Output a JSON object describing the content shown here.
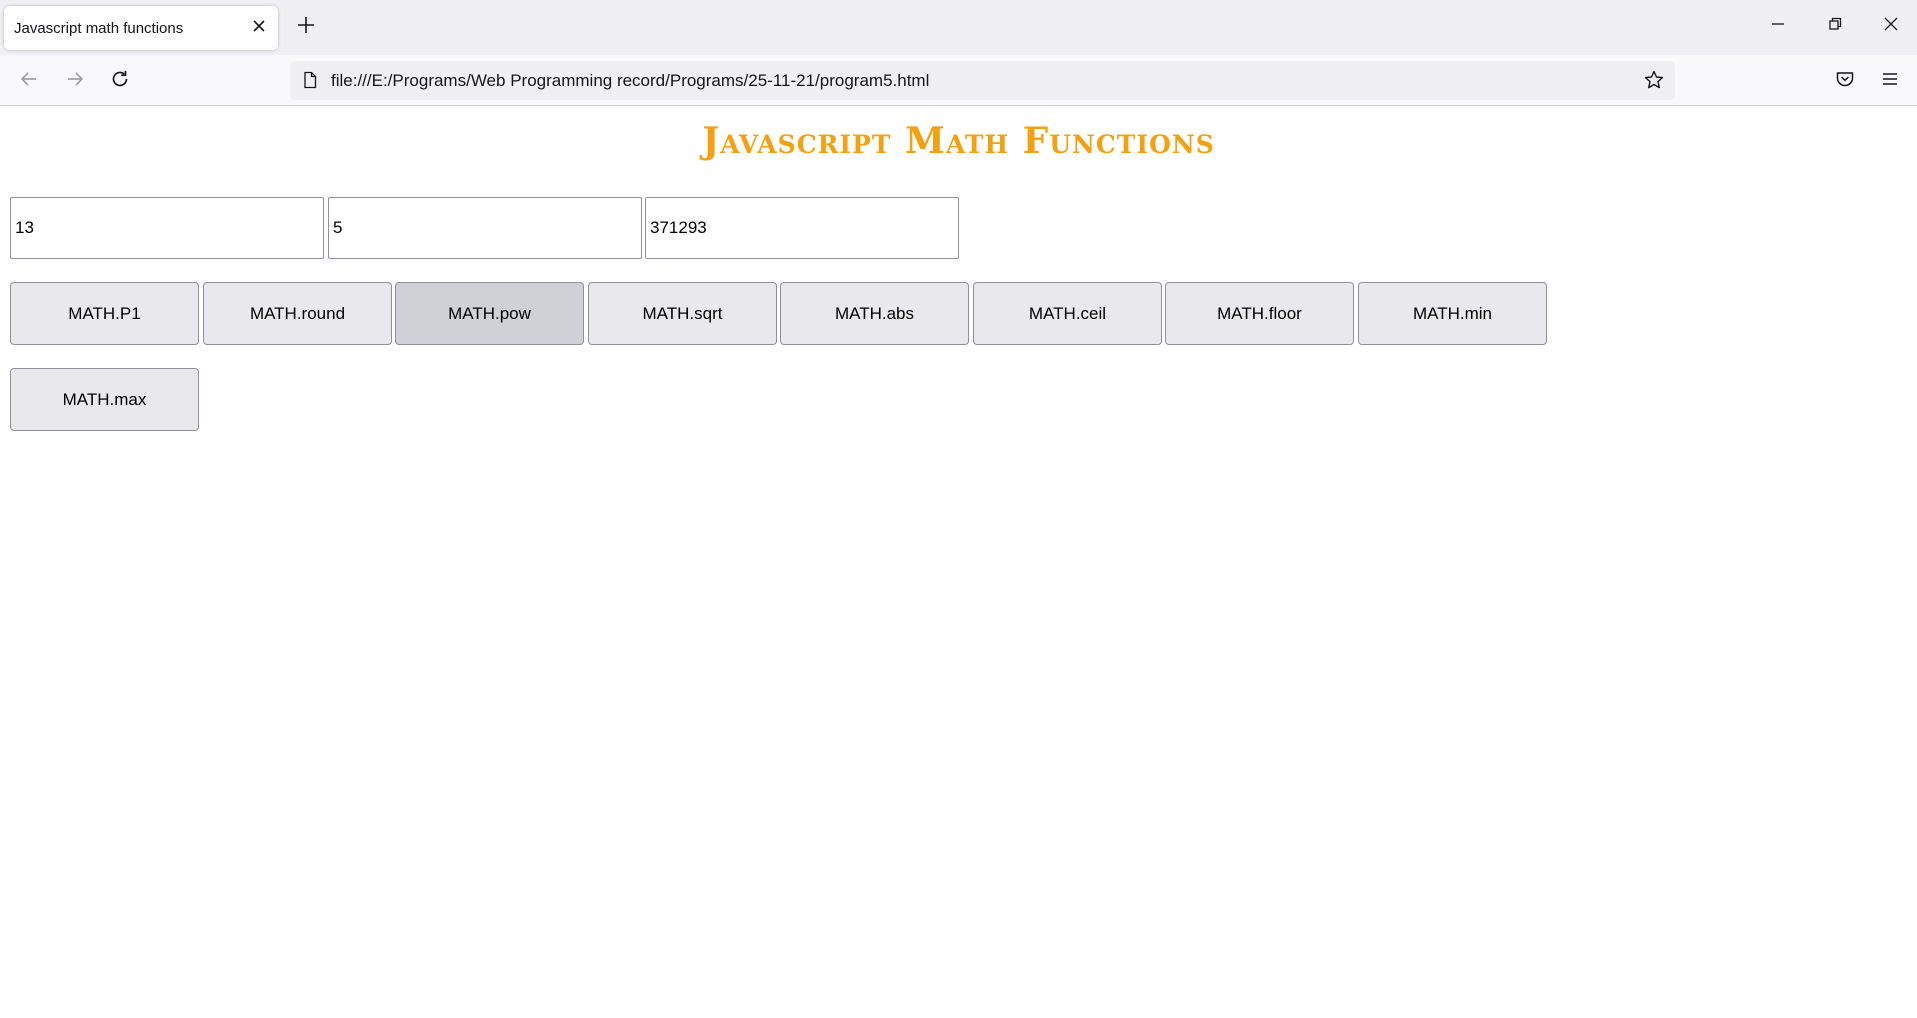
{
  "browser": {
    "tab_title": "Javascript math functions",
    "url": "file:///E:/Programs/Web Programming record/Programs/25-11-21/program5.html"
  },
  "page": {
    "heading": "Javascript Math Functions",
    "inputs": [
      "13",
      "5",
      "371293"
    ],
    "buttons": [
      {
        "label": "MATH.P1"
      },
      {
        "label": "MATH.round"
      },
      {
        "label": "MATH.pow"
      },
      {
        "label": "MATH.sqrt"
      },
      {
        "label": "MATH.abs"
      },
      {
        "label": "MATH.ceil"
      },
      {
        "label": "MATH.floor"
      },
      {
        "label": "MATH.min"
      },
      {
        "label": "MATH.max"
      }
    ]
  },
  "colors": {
    "heading": "#f5a00e",
    "button_bg": "#e9e9ed",
    "button_active_bg": "#d0d0d7"
  }
}
